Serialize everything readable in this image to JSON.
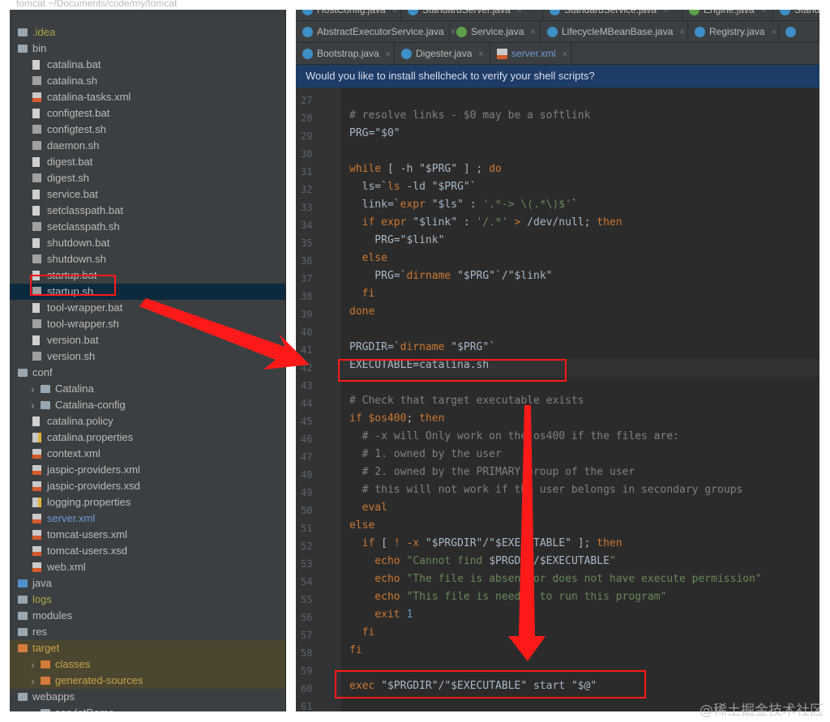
{
  "project_title": "tomcat  ~/Documents/code/my/tomcat",
  "tree": [
    {
      "level": 0,
      "icon": "folder",
      "label": ".idea",
      "color": "#a8a845"
    },
    {
      "level": 0,
      "icon": "folder",
      "label": "bin"
    },
    {
      "level": 1,
      "icon": "file",
      "label": "catalina.bat"
    },
    {
      "level": 1,
      "icon": "sh",
      "label": "catalina.sh"
    },
    {
      "level": 1,
      "icon": "xml",
      "label": "catalina-tasks.xml"
    },
    {
      "level": 1,
      "icon": "file",
      "label": "configtest.bat"
    },
    {
      "level": 1,
      "icon": "sh",
      "label": "configtest.sh"
    },
    {
      "level": 1,
      "icon": "sh",
      "label": "daemon.sh"
    },
    {
      "level": 1,
      "icon": "file",
      "label": "digest.bat"
    },
    {
      "level": 1,
      "icon": "sh",
      "label": "digest.sh"
    },
    {
      "level": 1,
      "icon": "file",
      "label": "service.bat"
    },
    {
      "level": 1,
      "icon": "file",
      "label": "setclasspath.bat"
    },
    {
      "level": 1,
      "icon": "sh",
      "label": "setclasspath.sh"
    },
    {
      "level": 1,
      "icon": "file",
      "label": "shutdown.bat"
    },
    {
      "level": 1,
      "icon": "sh",
      "label": "shutdown.sh"
    },
    {
      "level": 1,
      "icon": "file",
      "label": "startup.bat"
    },
    {
      "level": 1,
      "icon": "sh",
      "label": "startup.sh",
      "selected": true
    },
    {
      "level": 1,
      "icon": "file",
      "label": "tool-wrapper.bat"
    },
    {
      "level": 1,
      "icon": "sh",
      "label": "tool-wrapper.sh"
    },
    {
      "level": 1,
      "icon": "file",
      "label": "version.bat"
    },
    {
      "level": 1,
      "icon": "sh",
      "label": "version.sh"
    },
    {
      "level": 0,
      "icon": "folder",
      "label": "conf"
    },
    {
      "level": 1,
      "icon": "folder",
      "label": "Catalina",
      "collapsed": true
    },
    {
      "level": 1,
      "icon": "folder",
      "label": "Catalina-config",
      "collapsed": true
    },
    {
      "level": 1,
      "icon": "file",
      "label": "catalina.policy"
    },
    {
      "level": 1,
      "icon": "props",
      "label": "catalina.properties"
    },
    {
      "level": 1,
      "icon": "xml",
      "label": "context.xml"
    },
    {
      "level": 1,
      "icon": "xml",
      "label": "jaspic-providers.xml"
    },
    {
      "level": 1,
      "icon": "xml",
      "label": "jaspic-providers.xsd"
    },
    {
      "level": 1,
      "icon": "props",
      "label": "logging.properties"
    },
    {
      "level": 1,
      "icon": "xml",
      "label": "server.xml",
      "color": "#6e9ad6"
    },
    {
      "level": 1,
      "icon": "xml",
      "label": "tomcat-users.xml"
    },
    {
      "level": 1,
      "icon": "xml",
      "label": "tomcat-users.xsd"
    },
    {
      "level": 1,
      "icon": "xml",
      "label": "web.xml"
    },
    {
      "level": 0,
      "icon": "folder-blue",
      "label": "java"
    },
    {
      "level": 0,
      "icon": "folder",
      "label": "logs",
      "color": "#a8a845"
    },
    {
      "level": 0,
      "icon": "folder",
      "label": "modules"
    },
    {
      "level": 0,
      "icon": "folder",
      "label": "res"
    },
    {
      "level": 0,
      "icon": "folder-orange",
      "label": "target",
      "color": "#c9a44a",
      "excluded": true
    },
    {
      "level": 1,
      "icon": "folder-orange",
      "label": "classes",
      "collapsed": true,
      "color": "#c9a44a",
      "excluded": true
    },
    {
      "level": 1,
      "icon": "folder-orange",
      "label": "generated-sources",
      "collapsed": true,
      "color": "#c9a44a",
      "excluded": true
    },
    {
      "level": 0,
      "icon": "folder",
      "label": "webapps"
    },
    {
      "level": 1,
      "icon": "folder",
      "label": "servletDemo",
      "collapsed": true
    }
  ],
  "tab_rows": [
    [
      {
        "label": "HostConfig.java",
        "icon": "c"
      },
      {
        "label": "StandardServer.java",
        "icon": "c"
      },
      {
        "label": "StandardService.java",
        "icon": "c"
      },
      {
        "label": "Engine.java",
        "icon": "i"
      },
      {
        "label": "StandardEn",
        "icon": "c"
      }
    ],
    [
      {
        "label": "AbstractExecutorService.java",
        "icon": "c"
      },
      {
        "label": "Service.java",
        "icon": "i"
      },
      {
        "label": "LifecycleMBeanBase.java",
        "icon": "c"
      },
      {
        "label": "Registry.java",
        "icon": "c"
      },
      {
        "label": "",
        "icon": "c"
      }
    ],
    [
      {
        "label": "Bootstrap.java",
        "icon": "c"
      },
      {
        "label": "Digester.java",
        "icon": "c"
      },
      {
        "label": "server.xml",
        "icon": "x",
        "active": true
      }
    ]
  ],
  "banner": "Would you like to install shellcheck to verify your shell scripts?",
  "code_start": 27,
  "current_line": 42,
  "code": [
    [],
    [
      [
        "c",
        "# resolve links - $0 may be a softlink"
      ]
    ],
    [
      [
        "t",
        "PRG=\"$0\""
      ]
    ],
    [],
    [
      [
        "k",
        "while"
      ],
      [
        "t",
        " [ -h \"$PRG\" ] ; "
      ],
      [
        "k",
        "do"
      ]
    ],
    [
      [
        "t",
        "  ls=`"
      ],
      [
        "k",
        "ls"
      ],
      [
        "t",
        " -ld \"$PRG\"`"
      ]
    ],
    [
      [
        "t",
        "  link=`"
      ],
      [
        "k",
        "expr"
      ],
      [
        "t",
        " \"$ls\" : "
      ],
      [
        "s",
        "'.*-> \\(.*\\)$'"
      ],
      [
        "t",
        "`"
      ]
    ],
    [
      [
        "k",
        "  if expr"
      ],
      [
        "t",
        " \"$link\" : "
      ],
      [
        "s",
        "'/.*'"
      ],
      [
        "k",
        " > "
      ],
      [
        "t",
        "/dev/null; "
      ],
      [
        "k",
        "then"
      ]
    ],
    [
      [
        "t",
        "    PRG=\"$link\""
      ]
    ],
    [
      [
        "k",
        "  else"
      ]
    ],
    [
      [
        "t",
        "    PRG=`"
      ],
      [
        "k",
        "dirname"
      ],
      [
        "t",
        " \"$PRG\"`/\"$link\""
      ]
    ],
    [
      [
        "k",
        "  fi"
      ]
    ],
    [
      [
        "k",
        "done"
      ]
    ],
    [],
    [
      [
        "t",
        "PRGDIR=`"
      ],
      [
        "k",
        "dirname"
      ],
      [
        "t",
        " \"$PRG\"`"
      ]
    ],
    [
      [
        "t",
        "EXECUTABLE=catalina.sh"
      ]
    ],
    [],
    [
      [
        "c",
        "# Check that target executable exists"
      ]
    ],
    [
      [
        "k",
        "if"
      ],
      [
        "t",
        " "
      ],
      [
        "k",
        "$os400"
      ],
      [
        "t",
        "; "
      ],
      [
        "k",
        "then"
      ]
    ],
    [
      [
        "c",
        "  # -x will Only work on the os400 if the files are:"
      ]
    ],
    [
      [
        "c",
        "  # 1. owned by the user"
      ]
    ],
    [
      [
        "c",
        "  # 2. owned by the PRIMARY group of the user"
      ]
    ],
    [
      [
        "c",
        "  # this will not work if the user belongs in secondary groups"
      ]
    ],
    [
      [
        "k",
        "  eval"
      ]
    ],
    [
      [
        "k",
        "else"
      ]
    ],
    [
      [
        "k",
        "  if"
      ],
      [
        "t",
        " [ "
      ],
      [
        "k",
        "!"
      ],
      [
        "k",
        " -x"
      ],
      [
        "t",
        " \"$PRGDIR\"/\"$EXECUTABLE\" ]; "
      ],
      [
        "k",
        "then"
      ]
    ],
    [
      [
        "k",
        "    echo"
      ],
      [
        "s",
        " \"Cannot find "
      ],
      [
        "t",
        "$PRGDIR/$EXECUTABLE"
      ],
      [
        "s",
        "\""
      ]
    ],
    [
      [
        "k",
        "    echo"
      ],
      [
        "s",
        " \"The file is absent or does not have execute permission\""
      ]
    ],
    [
      [
        "k",
        "    echo"
      ],
      [
        "s",
        " \"This file is needed to run this program\""
      ]
    ],
    [
      [
        "k",
        "    exit"
      ],
      [
        "n",
        " 1"
      ]
    ],
    [
      [
        "k",
        "  fi"
      ]
    ],
    [
      [
        "k",
        "fi"
      ]
    ],
    [],
    [
      [
        "k",
        "exec"
      ],
      [
        "t",
        " \"$PRGDIR\"/\"$EXECUTABLE\" start \"$@\""
      ]
    ],
    []
  ],
  "annotation_color": "#ff1a1a",
  "watermark": "@稀土掘金技术社区"
}
